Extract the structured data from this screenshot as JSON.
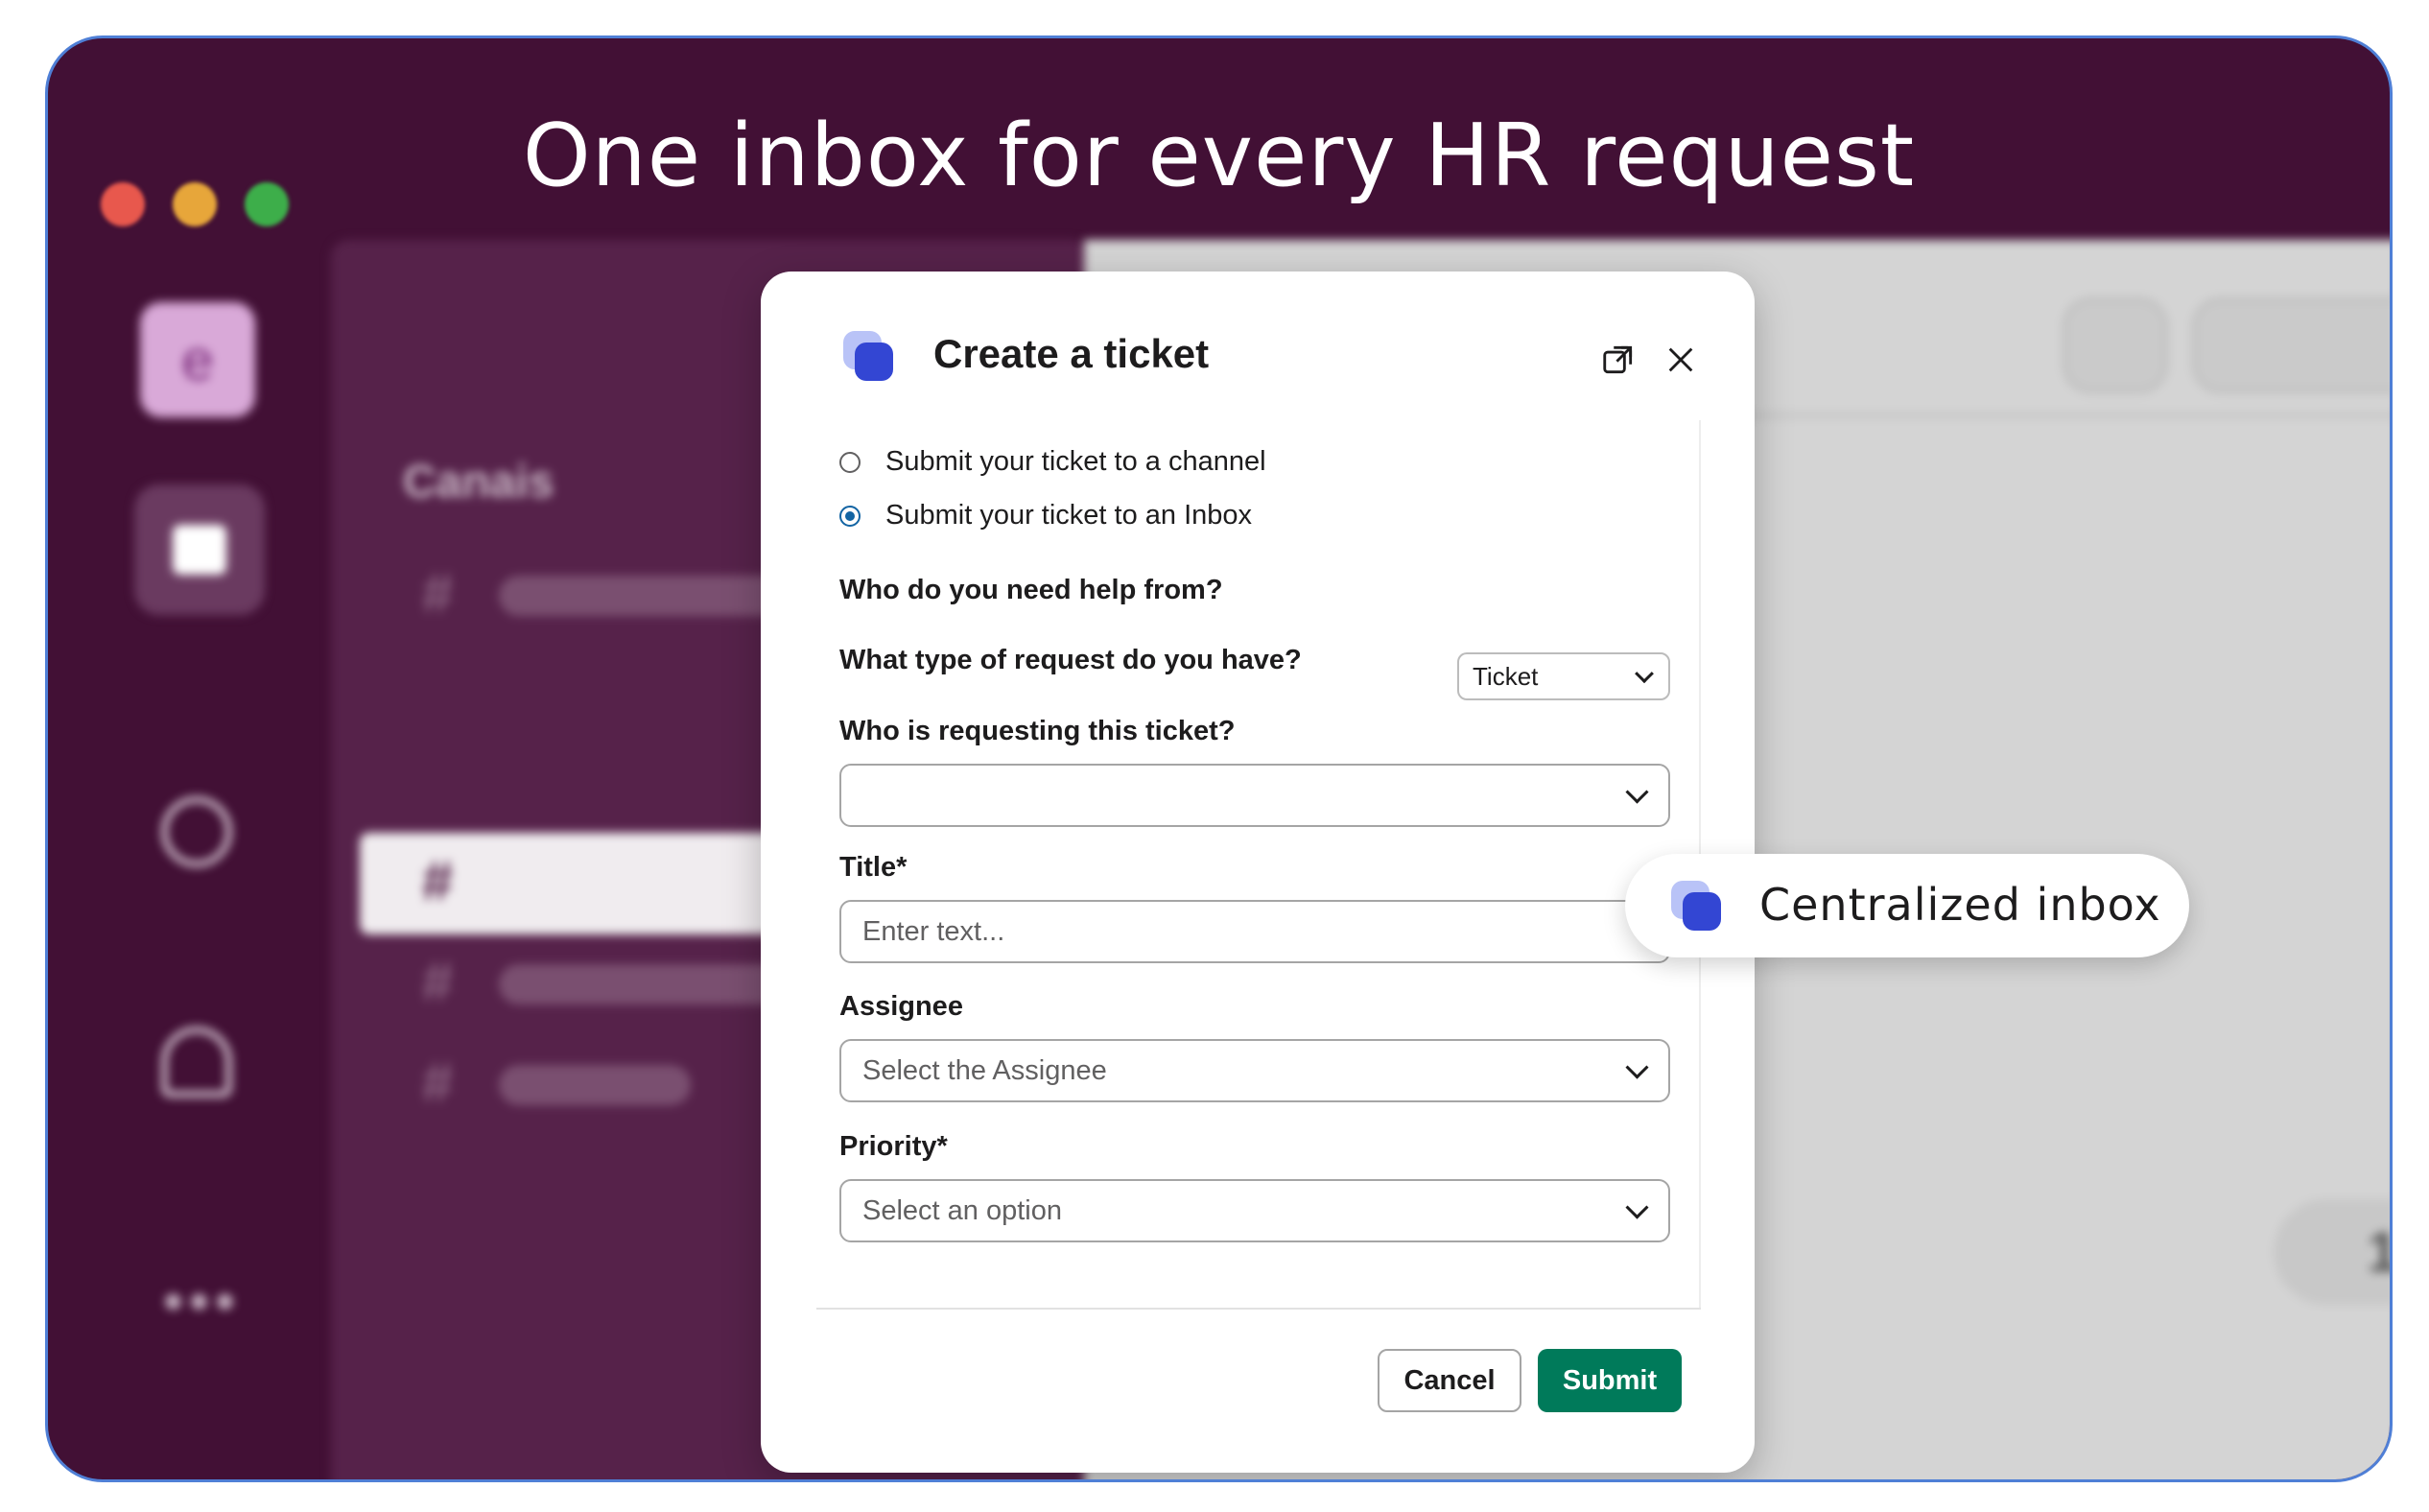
{
  "headline": "One inbox for every HR request",
  "sidebar": {
    "logo_letter": "e",
    "more_label": "•••"
  },
  "channels": {
    "title": "Canais",
    "hash": "#"
  },
  "reaction": {
    "count": "1"
  },
  "modal": {
    "title": "Create a ticket",
    "radio_options": [
      {
        "label": "Submit your ticket to a channel",
        "checked": false
      },
      {
        "label": "Submit your ticket to an Inbox",
        "checked": true
      }
    ],
    "help_question": "Who do you need help from?",
    "request_type_question": "What type of request do you have?",
    "request_type_value": "Ticket",
    "requester_question": "Who is requesting this ticket?",
    "requester_value": "",
    "title_label": "Title*",
    "title_placeholder": "Enter text...",
    "assignee_label": "Assignee",
    "assignee_placeholder": "Select the Assignee",
    "priority_label": "Priority*",
    "priority_placeholder": "Select an option",
    "cancel_label": "Cancel",
    "submit_label": "Submit"
  },
  "callout": {
    "text": "Centralized inbox"
  },
  "colors": {
    "frame_bg": "#421035",
    "frame_border": "#4f7fd6",
    "submit_green": "#007a5a",
    "radio_blue": "#1264a3",
    "brand_blue": "#3346d3"
  }
}
